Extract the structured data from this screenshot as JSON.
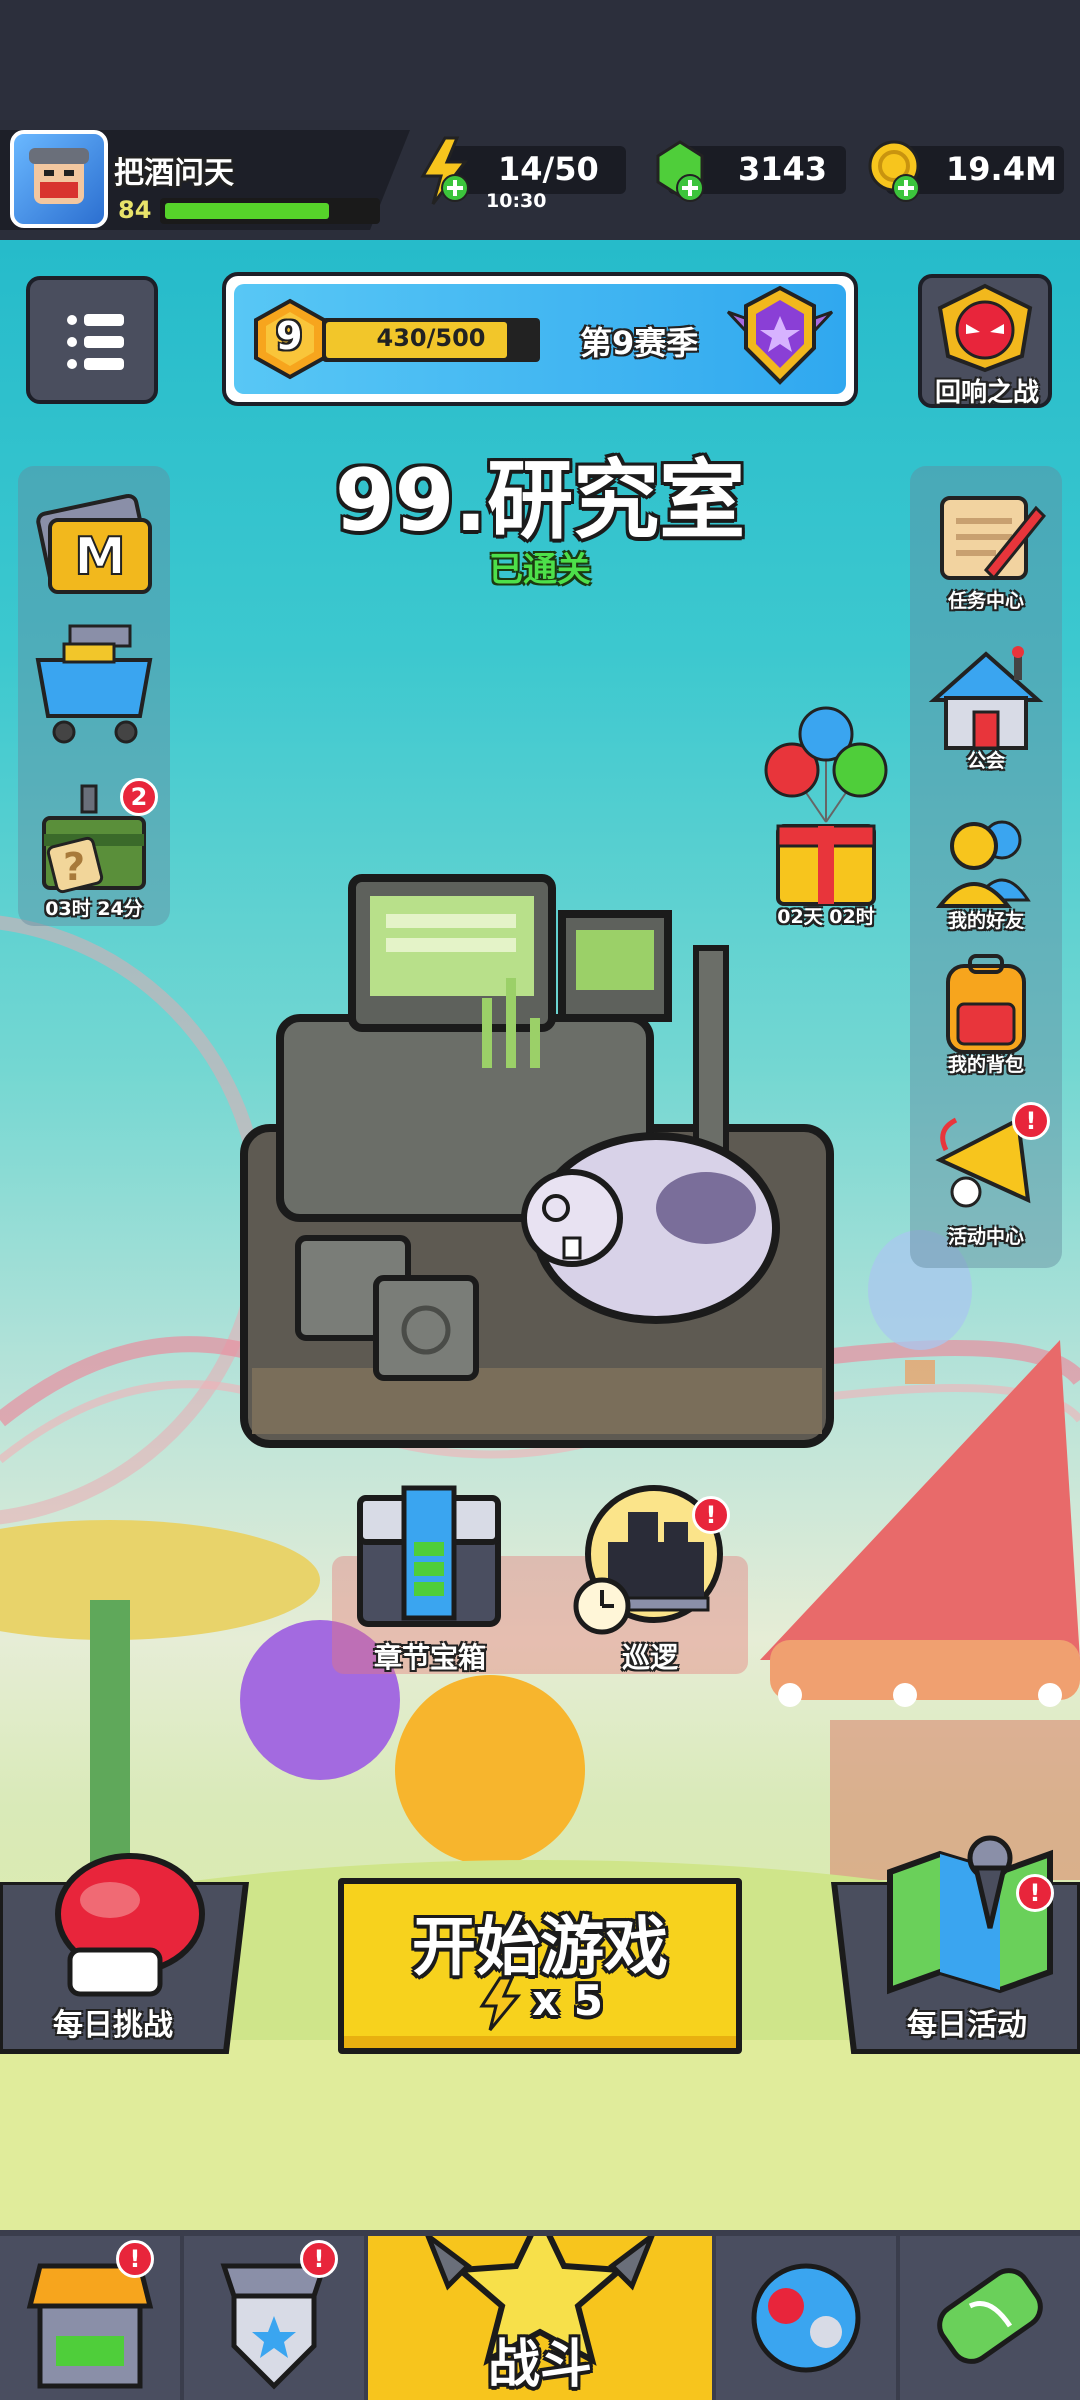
{
  "player": {
    "name": "把酒问天",
    "level": "84",
    "xp_fraction": 0.78
  },
  "resources": {
    "energy": "14/50",
    "energy_timer": "10:30",
    "gems": "3143",
    "coins": "19.4M"
  },
  "season": {
    "level": "9",
    "progress_text": "430/500",
    "progress_fraction": 0.86,
    "label": "第9赛季"
  },
  "event_button": {
    "label": "回响之战"
  },
  "stage": {
    "title": "99.研究室",
    "status": "已通关"
  },
  "left_panel": {
    "timer_label": "03时 24分",
    "mystery_badge": "2"
  },
  "gift": {
    "timer": "02天 02时"
  },
  "right_panel": {
    "items": [
      {
        "label": "任务中心"
      },
      {
        "label": "公会"
      },
      {
        "label": "我的好友"
      },
      {
        "label": "我的背包"
      },
      {
        "label": "活动中心"
      }
    ],
    "badge": "!"
  },
  "stage_actions": {
    "chest_label": "章节宝箱",
    "patrol_label": "巡逻",
    "patrol_badge": "!"
  },
  "bottom_actions": {
    "daily_challenge": "每日挑战",
    "start_game": "开始游戏",
    "start_cost": "x 5",
    "daily_event": "每日活动",
    "daily_event_badge": "!"
  },
  "bottom_nav": {
    "battle_label": "战斗",
    "shop_badge": "!",
    "talent_badge": "!"
  },
  "colors": {
    "accent_yellow": "#f7d21d",
    "badge_red": "#e8253b",
    "xp_green": "#56d32a",
    "season_bar": "#f2c62a"
  }
}
